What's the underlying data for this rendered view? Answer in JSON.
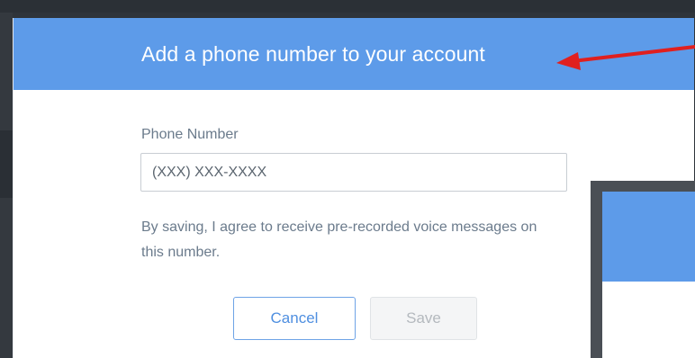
{
  "modal": {
    "title": "Add a phone number to your account",
    "phone_label": "Phone Number",
    "phone_placeholder": "(XXX) XXX-XXXX",
    "phone_value": "",
    "consent_text": "By saving, I agree to receive pre-recorded voice messages on this number.",
    "cancel_label": "Cancel",
    "save_label": "Save"
  },
  "colors": {
    "header": "#5d9be9",
    "annotation_arrow": "#e0201f",
    "cancel_border": "#6ea3e6",
    "save_disabled_bg": "#f4f5f6"
  },
  "annotation": {
    "icon": "red-arrow-annotation-icon"
  }
}
